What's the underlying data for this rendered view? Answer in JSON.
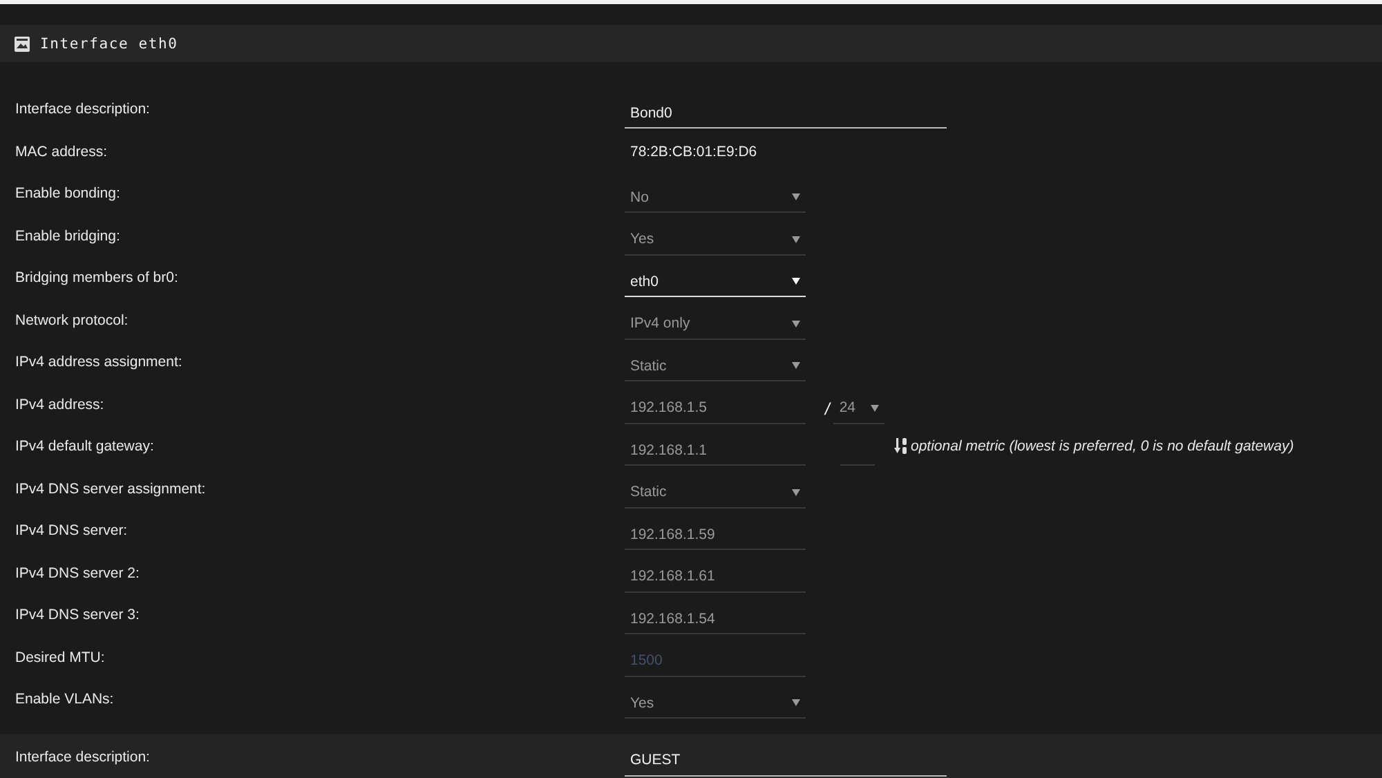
{
  "sections": [
    {
      "title": "Interface eth0",
      "rows": [
        {
          "label": "Interface description:",
          "kind": "text",
          "value": "Bond0"
        },
        {
          "label": "MAC address:",
          "kind": "static",
          "value": "78:2B:CB:01:E9:D6"
        },
        {
          "label": "Enable bonding:",
          "kind": "select",
          "value": "No",
          "focused": false
        },
        {
          "label": "Enable bridging:",
          "kind": "select",
          "value": "Yes",
          "focused": false
        },
        {
          "label": "Bridging members of br0:",
          "kind": "select",
          "value": "eth0",
          "focused": true
        },
        {
          "label": "Network protocol:",
          "kind": "select",
          "value": "IPv4 only",
          "focused": false
        },
        {
          "label": "IPv4 address assignment:",
          "kind": "select",
          "value": "Static",
          "focused": false
        },
        {
          "label": "IPv4 address:",
          "kind": "cidr",
          "value": "192.168.1.5",
          "separator": "/",
          "prefix": "24"
        },
        {
          "label": "IPv4 default gateway:",
          "kind": "gateway",
          "value": "192.168.1.1",
          "hint": "optional metric (lowest is preferred, 0 is no default gateway)"
        },
        {
          "label": "IPv4 DNS server assignment:",
          "kind": "select",
          "value": "Static",
          "focused": false
        },
        {
          "label": "IPv4 DNS server:",
          "kind": "input",
          "value": "192.168.1.59"
        },
        {
          "label": "IPv4 DNS server 2:",
          "kind": "input",
          "value": "192.168.1.61"
        },
        {
          "label": "IPv4 DNS server 3:",
          "kind": "input",
          "value": "192.168.1.54"
        },
        {
          "label": "Desired MTU:",
          "kind": "input",
          "placeholder": "1500"
        },
        {
          "label": "Enable VLANs:",
          "kind": "select",
          "value": "Yes",
          "focused": false
        }
      ]
    },
    {
      "rows": [
        {
          "label": "Interface description:",
          "kind": "text",
          "value": "GUEST"
        }
      ]
    }
  ]
}
